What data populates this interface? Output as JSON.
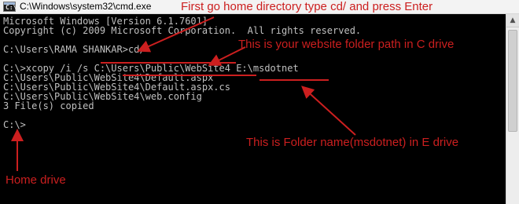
{
  "window": {
    "title": "C:\\Windows\\system32\\cmd.exe",
    "icon": "cmd-icon",
    "icon_glyph": "C:\\"
  },
  "console": {
    "lines": [
      "Microsoft Windows [Version 6.1.7601]",
      "Copyright (c) 2009 Microsoft Corporation.  All rights reserved.",
      "",
      "C:\\Users\\RAMA SHANKAR>cd/",
      "",
      "C:\\>xcopy /i /s C:\\Users\\Public\\WebSite4 E:\\msdotnet",
      "C:\\Users\\Public\\WebSite4\\Default.aspx",
      "C:\\Users\\Public\\WebSite4\\Default.aspx.cs",
      "C:\\Users\\Public\\WebSite4\\web.config",
      "3 File(s) copied",
      "",
      "C:\\>"
    ]
  },
  "annotations": {
    "cd_hint": "First go home directory type cd/ and press Enter",
    "website_path_hint": "This is your website folder path in C drive",
    "folder_name_hint": "This is Folder name(msdotnet) in E drive",
    "home_drive_hint": "Home drive",
    "color": "#cc1f1f"
  },
  "scrollbar": {
    "up_arrow_icon": "chevron-up-icon",
    "up_arrow_glyph": "▲"
  }
}
